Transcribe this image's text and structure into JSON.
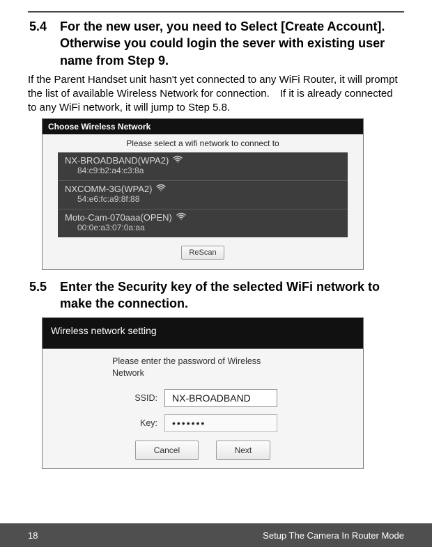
{
  "section54": {
    "number": "5.4",
    "title": "For the new user, you need to Select [Create Account]. Otherwise you could login the sever with existing user name from Step 9.",
    "paragraph": "If the Parent Handset unit hasn't yet connected to any WiFi Router, it will prompt the list of available Wireless Network for connection. If it is already connected to any WiFi network, it will jump to Step 5.8."
  },
  "shot1": {
    "header": "Choose Wireless Network",
    "subtitle": "Please select a wifi network to connect to",
    "networks": [
      {
        "ssid": "NX-BROADBAND(WPA2)",
        "mac": "84:c9:b2:a4:c3:8a"
      },
      {
        "ssid": "NXCOMM-3G(WPA2)",
        "mac": "54:e6:fc:a9:8f:88"
      },
      {
        "ssid": "Moto-Cam-070aaa(OPEN)",
        "mac": "00:0e:a3:07:0a:aa"
      }
    ],
    "button": "ReScan"
  },
  "section55": {
    "number": "5.5",
    "title": "Enter the Security key of the selected WiFi network to make the connection."
  },
  "shot2": {
    "header": "Wireless network setting",
    "message": "Please enter the password of Wireless Network",
    "ssid_label": "SSID:",
    "ssid_value": "NX-BROADBAND",
    "key_label": "Key:",
    "key_value": "•••••••",
    "cancel": "Cancel",
    "next": "Next"
  },
  "footer": {
    "page": "18",
    "section": "Setup The Camera In Router Mode"
  }
}
